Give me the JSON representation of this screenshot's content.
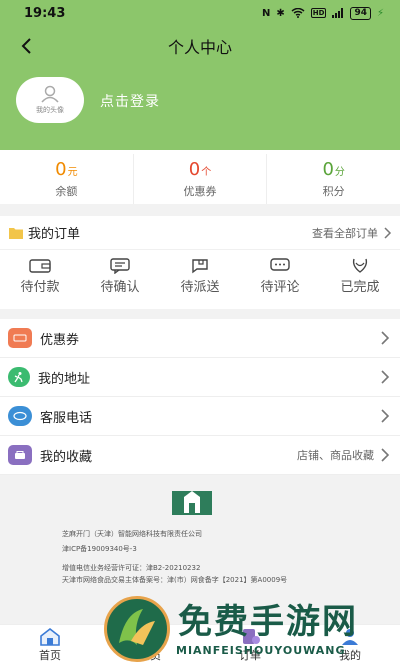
{
  "statusbar": {
    "time": "19:43",
    "battery": "94"
  },
  "header": {
    "title": "个人中心"
  },
  "profile": {
    "avatar_label": "我的头像",
    "login_text": "点击登录"
  },
  "stats": [
    {
      "value": "0",
      "unit": "元",
      "label": "余额",
      "color": "#f08a00"
    },
    {
      "value": "0",
      "unit": "个",
      "label": "优惠券",
      "color": "#e5482f"
    },
    {
      "value": "0",
      "unit": "分",
      "label": "积分",
      "color": "#5aa43a"
    }
  ],
  "orders": {
    "title": "我的订单",
    "all_label": "查看全部订单",
    "items": [
      {
        "label": "待付款",
        "icon": "wallet-icon"
      },
      {
        "label": "待确认",
        "icon": "confirm-icon"
      },
      {
        "label": "待派送",
        "icon": "delivery-icon"
      },
      {
        "label": "待评论",
        "icon": "comment-icon"
      },
      {
        "label": "已完成",
        "icon": "done-icon"
      }
    ]
  },
  "menu": [
    {
      "label": "优惠券",
      "extra": "",
      "icon": "coupon-icon",
      "color": "#f07b53"
    },
    {
      "label": "我的地址",
      "extra": "",
      "icon": "address-icon",
      "color": "#3bbb70"
    },
    {
      "label": "客服电话",
      "extra": "",
      "icon": "phone-icon",
      "color": "#3b8fd6"
    },
    {
      "label": "我的收藏",
      "extra": "店铺、商品收藏",
      "icon": "favorite-icon",
      "color": "#8a6fc0"
    }
  ],
  "footer_info": {
    "company": "芝麻开门（天津）智能网络科技有限责任公司",
    "icp": "津ICP备19009340号-3",
    "telecom": "增值电信业务经营许可证：津B2-20210232",
    "food": "天津市网络食品交易主体备案号：津(市）网食备字【2021】第A0009号"
  },
  "tabbar": [
    {
      "label": "首页",
      "icon": "home-icon"
    },
    {
      "label": "会员",
      "icon": "member-icon"
    },
    {
      "label": "订单",
      "icon": "order-icon"
    },
    {
      "label": "我的",
      "icon": "profile-icon"
    }
  ],
  "watermark": {
    "title": "免费手游网",
    "subtitle": "MIANFEISHOUYOUWANG"
  },
  "colors": {
    "header": "#8cc66b",
    "background": "#f2f2f2"
  }
}
